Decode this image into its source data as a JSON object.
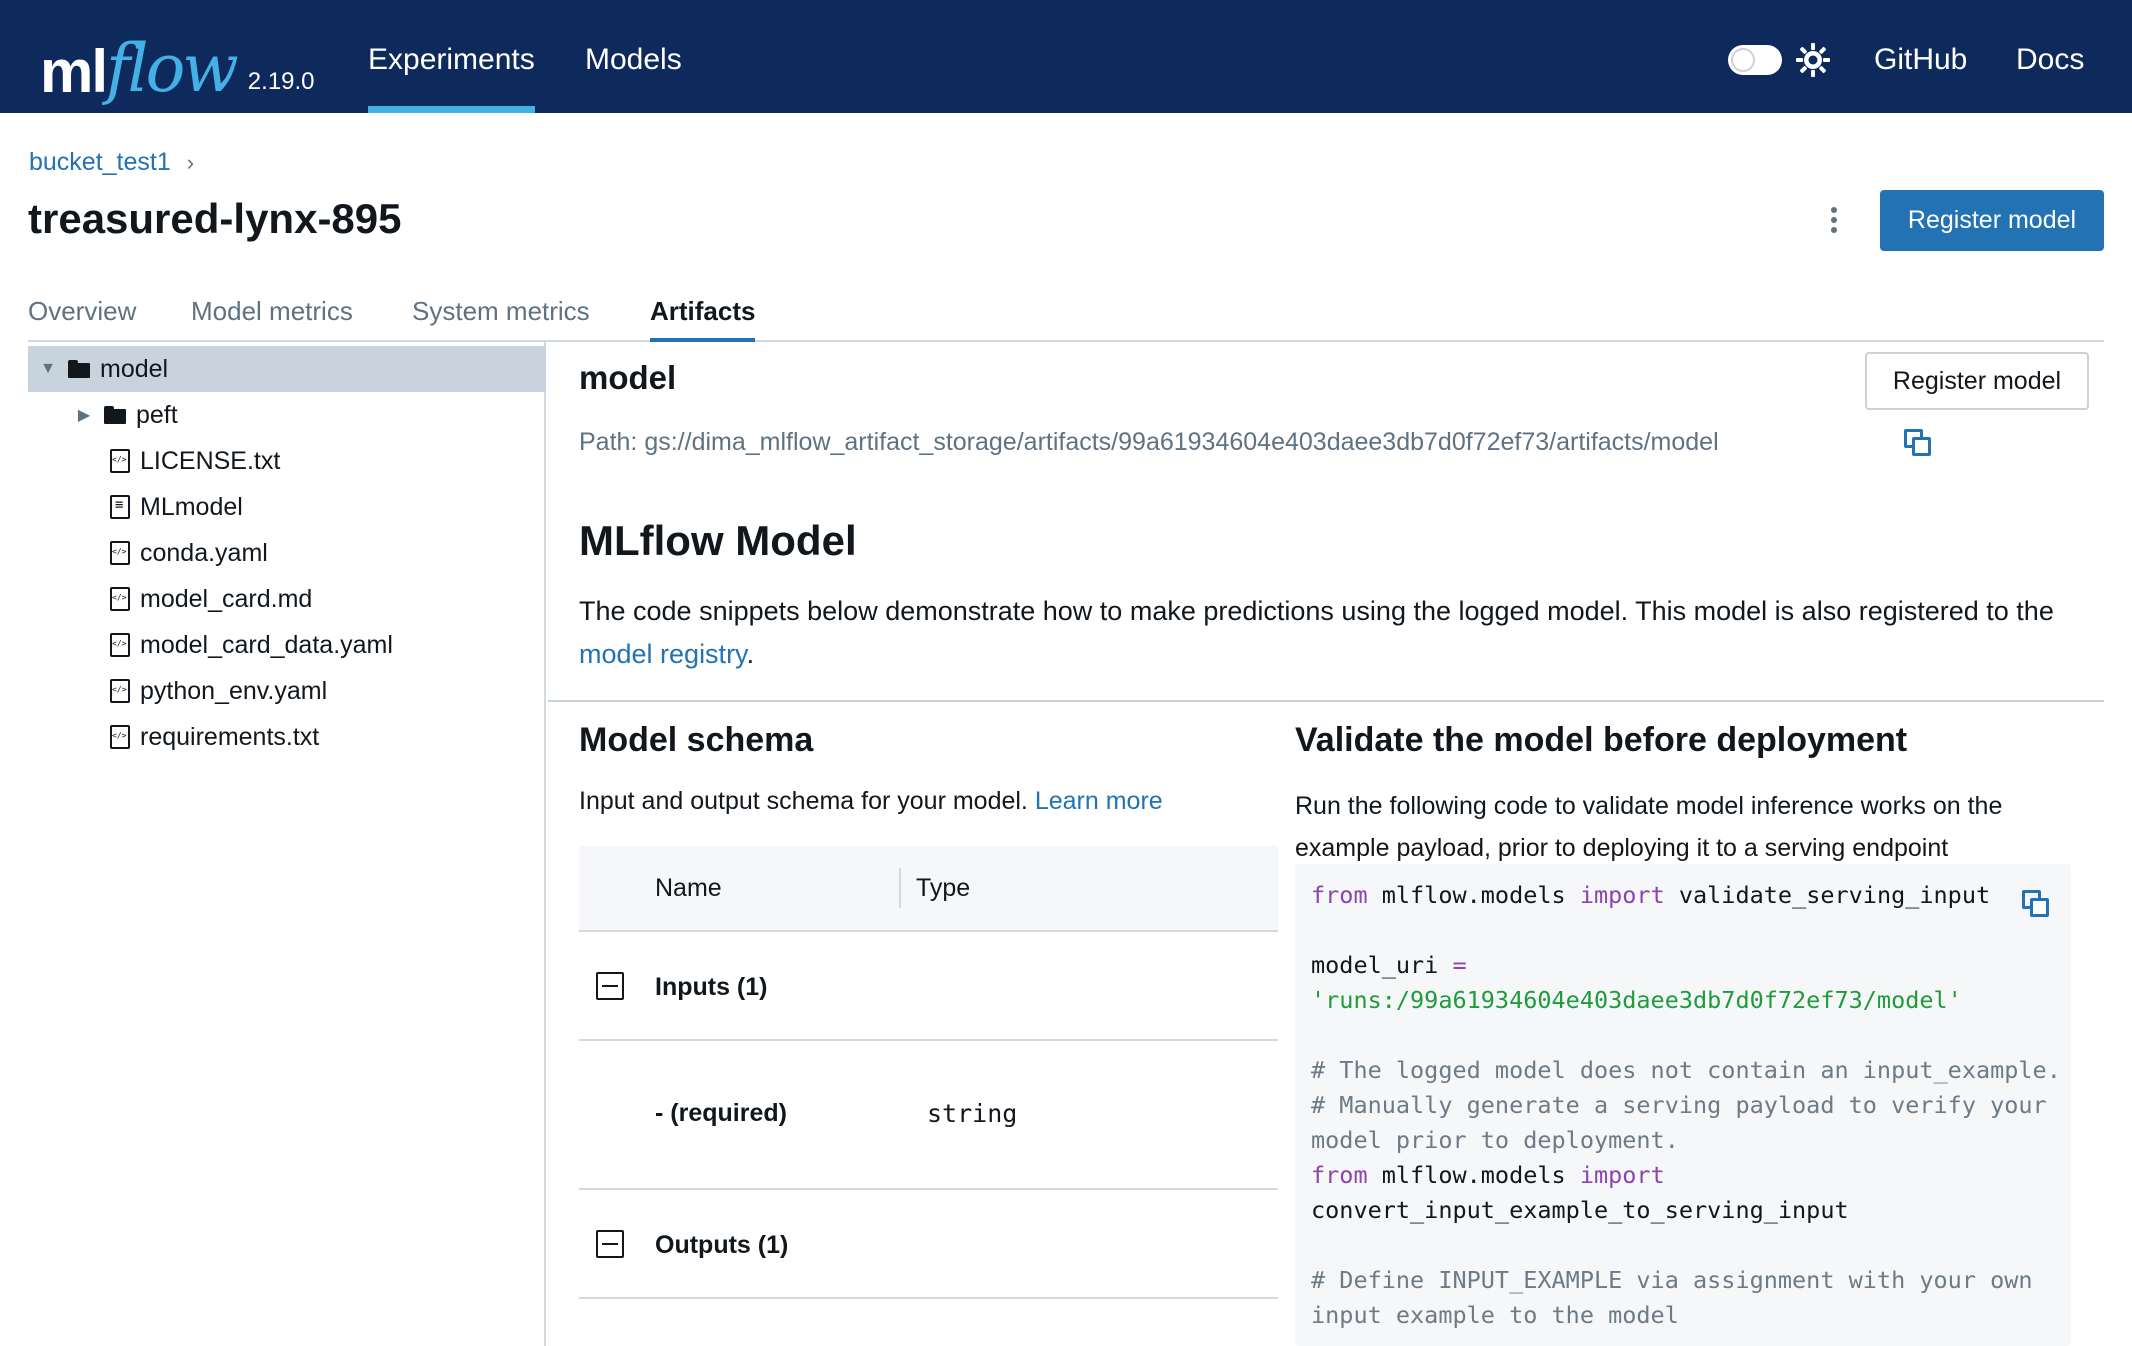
{
  "nav": {
    "logo_ml": "ml",
    "logo_flow": "flow",
    "version": "2.19.0",
    "experiments": "Experiments",
    "models": "Models",
    "github": "GitHub",
    "docs": "Docs",
    "theme_toggle_on": false,
    "accent_color": "#43b1e6",
    "bar_color": "#0e2a5c"
  },
  "header": {
    "breadcrumb": "bucket_test1",
    "title": "treasured-lynx-895",
    "register_button": "Register model"
  },
  "tabs": [
    {
      "label": "Overview",
      "active": false
    },
    {
      "label": "Model metrics",
      "active": false
    },
    {
      "label": "System metrics",
      "active": false
    },
    {
      "label": "Artifacts",
      "active": true
    }
  ],
  "tree": {
    "root": "model",
    "items": [
      {
        "label": "peft",
        "type": "folder"
      },
      {
        "label": "LICENSE.txt",
        "type": "file-code"
      },
      {
        "label": "MLmodel",
        "type": "file-doc"
      },
      {
        "label": "conda.yaml",
        "type": "file-code"
      },
      {
        "label": "model_card.md",
        "type": "file-code"
      },
      {
        "label": "model_card_data.yaml",
        "type": "file-code"
      },
      {
        "label": "python_env.yaml",
        "type": "file-code"
      },
      {
        "label": "requirements.txt",
        "type": "file-code"
      }
    ]
  },
  "artifact": {
    "title": "model",
    "register_button": "Register model",
    "path_label": "Path:",
    "path": "gs://dima_mlflow_artifact_storage/artifacts/99a61934604e403daee3db7d0f72ef73/artifacts/model",
    "section_title": "MLflow Model",
    "description": "The code snippets below demonstrate how to make predictions using the logged model. This model is also registered to the",
    "registry_link": "model registry",
    "registry_suffix": "."
  },
  "schema": {
    "title": "Model schema",
    "subtitle": "Input and output schema for your model.",
    "learn_more": "Learn more",
    "col_name": "Name",
    "col_type": "Type",
    "inputs_label": "Inputs (1)",
    "input_name": "- (required)",
    "input_type": "string",
    "outputs_label": "Outputs (1)"
  },
  "validate": {
    "title": "Validate the model before deployment",
    "description": "Run the following code to validate model inference works on the example payload, prior to deploying it to a serving endpoint",
    "code": {
      "l1_from": "from",
      "l1_mod": " mlflow.models ",
      "l1_import": "import",
      "l1_name": " validate_serving_input",
      "l3_var": "model_uri ",
      "l3_eq": "=",
      "l4_str": "'runs:/99a61934604e403daee3db7d0f72ef73/model'",
      "l6_cm": "# The logged model does not contain an input_example.",
      "l7_cm": "# Manually generate a serving payload to verify your",
      "l8_cm": "model prior to deployment.",
      "l9_from": "from",
      "l9_mod": " mlflow.models ",
      "l9_import": "import",
      "l10_name": "convert_input_example_to_serving_input",
      "l12_cm": "# Define INPUT_EXAMPLE via assignment with your own",
      "l13_cm": "input example to the model"
    }
  }
}
